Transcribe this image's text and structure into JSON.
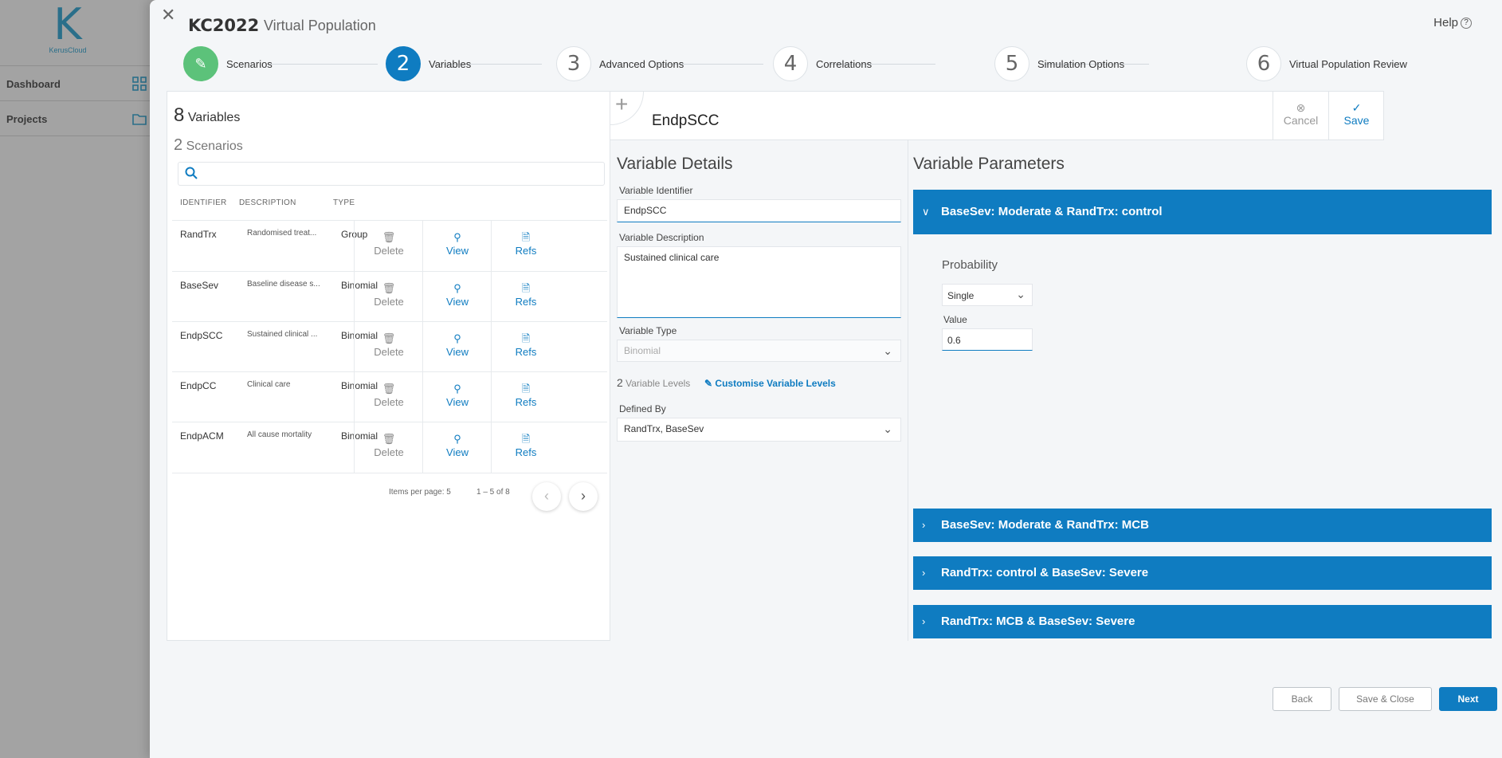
{
  "background_app": {
    "logo_caption": "KerusCloud",
    "nav": [
      {
        "label": "Dashboard",
        "icon": "grid-icon"
      },
      {
        "label": "Projects",
        "icon": "folder-icon"
      }
    ]
  },
  "modal": {
    "title": "KC2022",
    "subtitle": "Virtual Population",
    "help_label": "Help"
  },
  "stepper": [
    {
      "number": "",
      "label": "Scenarios",
      "state": "done"
    },
    {
      "number": "2",
      "label": "Variables",
      "state": "active"
    },
    {
      "number": "3",
      "label": "Advanced Options",
      "state": "pending"
    },
    {
      "number": "4",
      "label": "Correlations",
      "state": "pending"
    },
    {
      "number": "5",
      "label": "Simulation Options",
      "state": "pending"
    },
    {
      "number": "6",
      "label": "Virtual Population Review",
      "state": "pending"
    }
  ],
  "variables_panel": {
    "variables_count": "8",
    "variables_label": "Variables",
    "scenarios_count": "2",
    "scenarios_label": "Scenarios",
    "search_placeholder": "",
    "columns": [
      "IDENTIFIER",
      "DESCRIPTION",
      "TYPE"
    ],
    "rows": [
      {
        "identifier": "RandTrx",
        "description": "Randomised treat...",
        "type": "Group"
      },
      {
        "identifier": "BaseSev",
        "description": "Baseline disease s...",
        "type": "Binomial"
      },
      {
        "identifier": "EndpSCC",
        "description": "Sustained clinical ...",
        "type": "Binomial"
      },
      {
        "identifier": "EndpCC",
        "description": "Clinical care",
        "type": "Binomial"
      },
      {
        "identifier": "EndpACM",
        "description": "All cause mortality",
        "type": "Binomial"
      }
    ],
    "actions": {
      "delete": "Delete",
      "view": "View",
      "refs": "Refs"
    },
    "pagination": {
      "items_per_page_label": "Items per page:",
      "items_per_page": "5",
      "range": "1 – 5 of 8"
    }
  },
  "editor": {
    "variable_name": "EndpSCC",
    "cancel_label": "Cancel",
    "save_label": "Save",
    "details": {
      "heading": "Variable Details",
      "identifier_label": "Variable Identifier",
      "identifier_value": "EndpSCC",
      "description_label": "Variable Description",
      "description_value": "Sustained clinical care",
      "type_label": "Variable Type",
      "type_value": "Binomial",
      "levels_count": "2",
      "levels_label": "Variable Levels",
      "customise_label": "Customise Variable Levels",
      "defined_by_label": "Defined By",
      "defined_by_value": "RandTrx, BaseSev"
    },
    "parameters": {
      "heading": "Variable Parameters",
      "sections": [
        {
          "title": "BaseSev: Moderate & RandTrx: control",
          "expanded": true
        },
        {
          "title": "BaseSev: Moderate & RandTrx: MCB",
          "expanded": false
        },
        {
          "title": "RandTrx: control & BaseSev: Severe",
          "expanded": false
        },
        {
          "title": "RandTrx: MCB & BaseSev: Severe",
          "expanded": false
        }
      ],
      "probability_label": "Probability",
      "probability_mode": "Single",
      "value_label": "Value",
      "value": "0.6"
    }
  },
  "footer": {
    "back_label": "Back",
    "save_close_label": "Save & Close",
    "next_label": "Next"
  },
  "colors": {
    "primary": "#0f7cc1",
    "success": "#5cc27a"
  }
}
